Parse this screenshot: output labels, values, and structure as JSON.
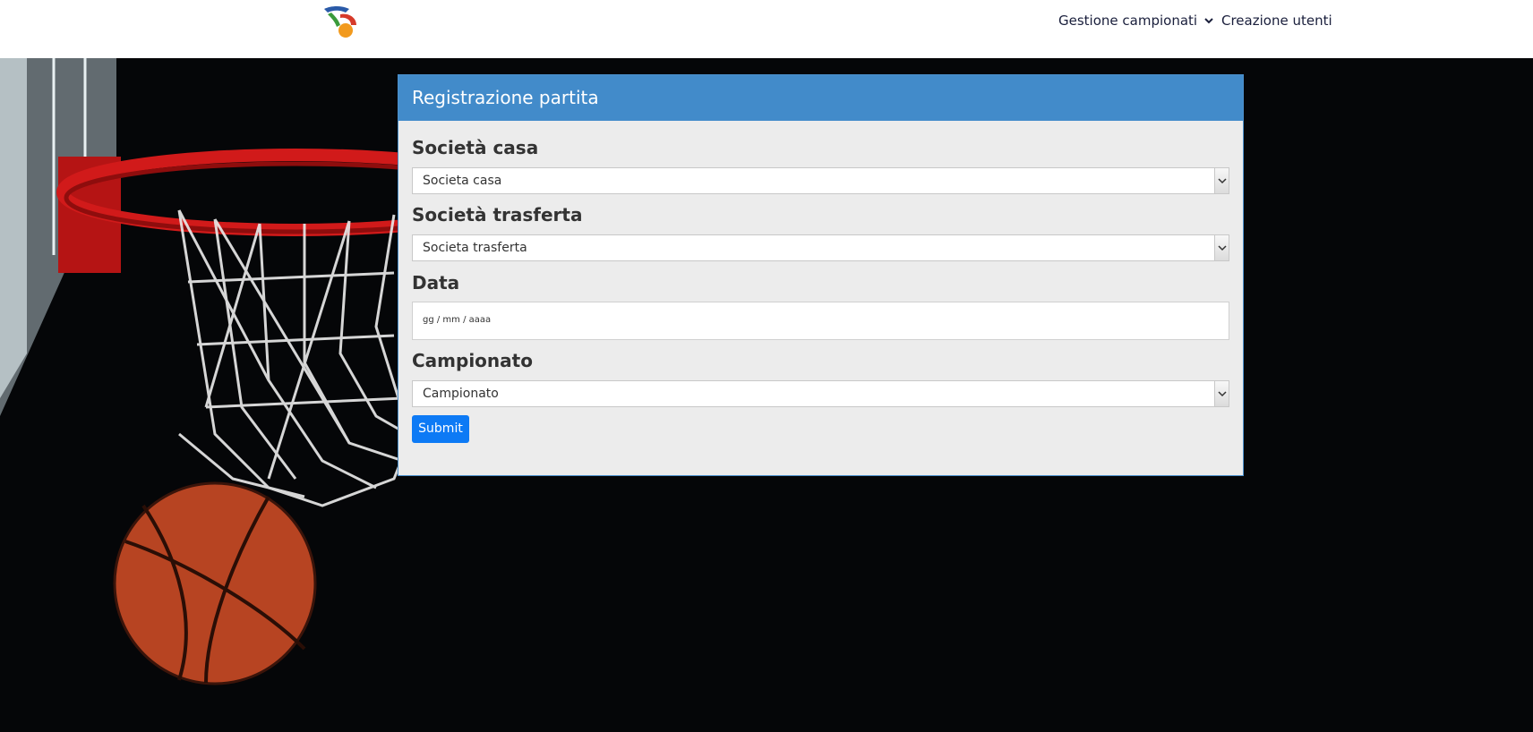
{
  "nav": {
    "campionati_label": "Gestione campionati",
    "utenti_label": "Creazione utenti"
  },
  "form": {
    "title": "Registrazione partita",
    "casa": {
      "label": "Società casa",
      "value": "Societa casa"
    },
    "trasferta": {
      "label": "Società trasferta",
      "value": "Societa trasferta"
    },
    "data": {
      "label": "Data",
      "placeholder": "gg / mm / aaaa"
    },
    "campionato": {
      "label": "Campionato",
      "value": "Campionato"
    },
    "submit_label": "Submit"
  },
  "colors": {
    "panel_header": "#428bca",
    "submit": "#0d7af5",
    "background": "#050608"
  },
  "icons": {
    "logo": "federation-logo",
    "dropdown": "chevron-down-icon"
  }
}
